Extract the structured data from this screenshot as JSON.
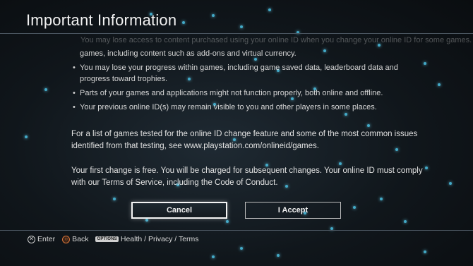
{
  "header": {
    "title": "Important Information"
  },
  "content": {
    "faded_line": "You may lose access to content purchased using your online ID when you change your online ID for some games.",
    "bullets": [
      {
        "text": "games, including content such as add-ons and virtual currency.",
        "continuation": true
      },
      {
        "text": "You may lose your progress within games, including game saved data, leaderboard data and progress toward trophies."
      },
      {
        "text": "Parts of your games and applications might not function properly, both online and offline."
      },
      {
        "text": "Your previous online ID(s) may remain visible to you and other players in some places."
      }
    ],
    "paragraph_1": "For a list of games tested for the online ID change feature and some of the most common issues identified from that testing, see www.playstation.com/onlineid/games.",
    "paragraph_2": "Your first change is free. You will be charged for subsequent changes. Your online ID must comply with our Terms of Service, including the Code of Conduct."
  },
  "buttons": {
    "cancel": "Cancel",
    "accept": "I Accept"
  },
  "footer": {
    "enter": {
      "icon": "cross-button-icon",
      "label": "Enter"
    },
    "back": {
      "icon": "circle-button-icon",
      "label": "Back"
    },
    "options": {
      "badge": "OPTIONS",
      "label": "Health / Privacy / Terms"
    }
  },
  "colors": {
    "accent_particles": "#4cc4e6",
    "background": "#10161b"
  }
}
